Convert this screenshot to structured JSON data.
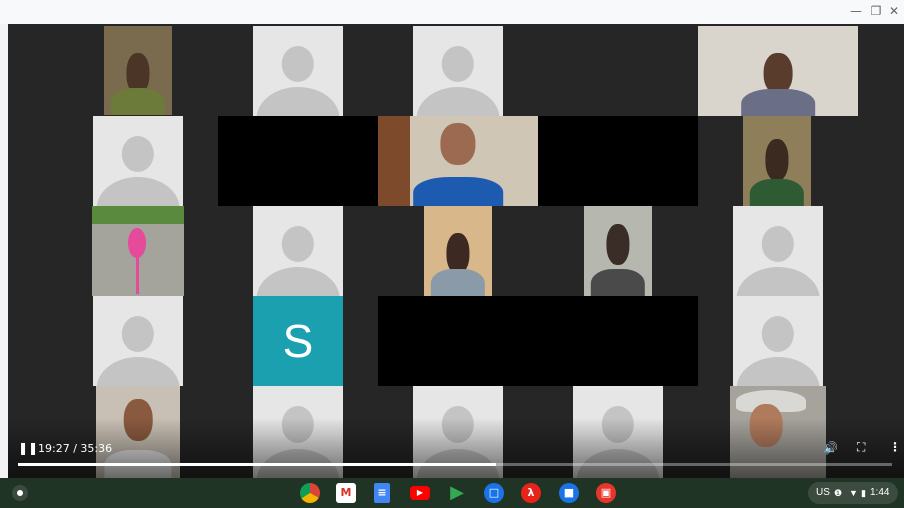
{
  "window": {
    "minimize_icon": "minimize-icon",
    "restore_icon": "restore-icon",
    "close_icon": "close-icon"
  },
  "participants": [
    {
      "kind": "camera",
      "label": ""
    },
    {
      "kind": "placeholder"
    },
    {
      "kind": "placeholder"
    },
    {
      "kind": "camera",
      "label": ""
    },
    {
      "kind": "placeholder"
    },
    {
      "kind": "blackout"
    },
    {
      "kind": "camera",
      "label": ""
    },
    {
      "kind": "blackout"
    },
    {
      "kind": "camera",
      "label": ""
    },
    {
      "kind": "camera",
      "label": ""
    },
    {
      "kind": "placeholder"
    },
    {
      "kind": "camera",
      "label": ""
    },
    {
      "kind": "camera",
      "label": ""
    },
    {
      "kind": "placeholder"
    },
    {
      "kind": "placeholder"
    },
    {
      "kind": "initial",
      "label": "S"
    },
    {
      "kind": "blackout"
    },
    {
      "kind": "placeholder"
    },
    {
      "kind": "camera",
      "label": ""
    },
    {
      "kind": "placeholder"
    },
    {
      "kind": "placeholder"
    },
    {
      "kind": "placeholder"
    },
    {
      "kind": "camera",
      "label": ""
    }
  ],
  "player": {
    "time": "19:27 / 35:36",
    "progress": 0.5465,
    "play_state_icon": "pause-icon",
    "volume_icon": "volume-icon",
    "fullscreen_icon": "fullscreen-icon",
    "more_icon": "more-vert-icon"
  },
  "shelf": {
    "apps": [
      "chrome-icon",
      "gmail-icon",
      "docs-icon",
      "youtube-icon",
      "play-store-icon",
      "messages-icon",
      "acrobat-reader-icon",
      "files-icon",
      "screencast-icon"
    ],
    "tray": {
      "locale": "US",
      "time": "1:44"
    }
  },
  "colors": {
    "initial_tile": "#1ba0b0",
    "shelf": "#1f3424",
    "video_bg": "#262626"
  }
}
